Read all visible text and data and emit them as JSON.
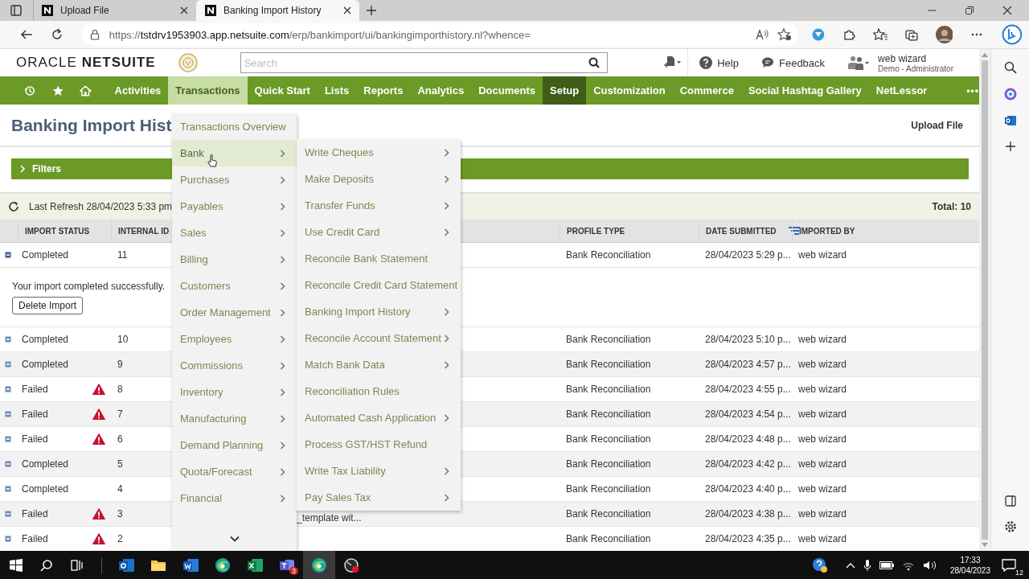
{
  "browser": {
    "tabs": [
      {
        "title": "Upload File",
        "selected": false
      },
      {
        "title": "Banking Import History",
        "selected": true
      }
    ],
    "address": {
      "scheme": "https://",
      "host": "tstdrv1953903.app.netsuite.com",
      "path": "/erp/bankimport/ui/bankingimporthistory.nl?whence="
    }
  },
  "header": {
    "logo": "ORACLE **NETSUITE**",
    "search": {
      "placeholder": "Search"
    },
    "help": "Help",
    "feedback": "Feedback",
    "user": {
      "name": "web wizard",
      "role": "Demo - Administrator"
    }
  },
  "nav": [
    {
      "kind": "recent"
    },
    {
      "kind": "favorites"
    },
    {
      "kind": "home"
    },
    {
      "kind": "menu",
      "label": "Activities",
      "selected": false,
      "current": false
    },
    {
      "kind": "menu",
      "label": "Transactions",
      "selected": true,
      "current": false
    },
    {
      "kind": "menu",
      "label": "Quick Start",
      "selected": false,
      "current": false
    },
    {
      "kind": "menu",
      "label": "Lists",
      "selected": false,
      "current": false
    },
    {
      "kind": "menu",
      "label": "Reports",
      "selected": false,
      "current": false
    },
    {
      "kind": "menu",
      "label": "Analytics",
      "selected": false,
      "current": false
    },
    {
      "kind": "menu",
      "label": "Documents",
      "selected": false,
      "current": false
    },
    {
      "kind": "menu",
      "label": "Setup",
      "selected": false,
      "current": true
    },
    {
      "kind": "menu",
      "label": "Customization",
      "selected": false,
      "current": false
    },
    {
      "kind": "menu",
      "label": "Commerce",
      "selected": false,
      "current": false
    },
    {
      "kind": "menu",
      "label": "Social Hashtag Gallery",
      "selected": false,
      "current": false
    },
    {
      "kind": "menu",
      "label": "NetLessor",
      "selected": false,
      "current": false
    },
    {
      "kind": "more",
      "label": "•••"
    }
  ],
  "page": {
    "title": "Banking Import Hist",
    "action": "Upload File",
    "filters": "Filters",
    "last_refresh": "Last Refresh 28/04/2023 5:33 pm",
    "total": "Total: 10"
  },
  "table": {
    "columns": [
      {
        "label": "IMPORT STATUS",
        "sorted": false
      },
      {
        "label": "INTERNAL ID",
        "sorted": false
      },
      {
        "label": "PROFILE TYPE",
        "sorted": false
      },
      {
        "label": "DATE SUBMITTED",
        "sorted": true
      },
      {
        "label": "IMPORTED BY",
        "sorted": false
      }
    ],
    "rows": [
      {
        "status": "Completed",
        "failed": false,
        "id": "11",
        "profile": "Bank Reconciliation",
        "date": "28/04/2023 5:29 p...",
        "by": "web wizard",
        "expanded": true,
        "detail": {
          "message": "Your import completed successfully.",
          "button": "Delete Import"
        }
      },
      {
        "status": "Completed",
        "failed": false,
        "id": "10",
        "profile": "Bank Reconciliation",
        "date": "28/04/2023 5:10 p...",
        "by": "web wizard",
        "expanded": false
      },
      {
        "status": "Completed",
        "failed": false,
        "id": "9",
        "profile": "Bank Reconciliation",
        "date": "28/04/2023 4:57 p...",
        "by": "web wizard",
        "expanded": false
      },
      {
        "status": "Failed",
        "failed": true,
        "id": "8",
        "profile": "Bank Reconciliation",
        "date": "28/04/2023 4:55 p...",
        "by": "web wizard",
        "expanded": false
      },
      {
        "status": "Failed",
        "failed": true,
        "id": "7",
        "profile": "Bank Reconciliation",
        "date": "28/04/2023 4:54 p...",
        "by": "web wizard",
        "expanded": false
      },
      {
        "status": "Failed",
        "failed": true,
        "id": "6",
        "profile": "Bank Reconciliation",
        "date": "28/04/2023 4:48 p...",
        "by": "web wizard",
        "expanded": false
      },
      {
        "status": "Completed",
        "failed": false,
        "id": "5",
        "profile": "Bank Reconciliation",
        "date": "28/04/2023 4:42 p...",
        "by": "web wizard",
        "expanded": false
      },
      {
        "status": "Completed",
        "failed": false,
        "id": "4",
        "profile": "Bank Reconciliation",
        "date": "28/04/2023 4:40 p...",
        "by": "web wizard",
        "expanded": false
      },
      {
        "status": "Failed",
        "failed": true,
        "id": "3",
        "column_3": "_template wit...",
        "profile": "Bank Reconciliation",
        "date": "28/04/2023 4:38 p...",
        "by": "web wizard",
        "expanded": false
      },
      {
        "status": "Failed",
        "failed": true,
        "id": "2",
        "profile": "Bank Reconciliation",
        "date": "28/04/2023 4:35 p...",
        "by": "web wizard",
        "expanded": false
      }
    ]
  },
  "menus": [
    {
      "items": [
        {
          "label": "Transactions Overview",
          "submenu": false,
          "selected": false
        },
        {
          "label": "Bank",
          "submenu": true,
          "selected": true
        },
        {
          "label": "Purchases",
          "submenu": true,
          "selected": false
        },
        {
          "label": "Payables",
          "submenu": true,
          "selected": false
        },
        {
          "label": "Sales",
          "submenu": true,
          "selected": false
        },
        {
          "label": "Billing",
          "submenu": true,
          "selected": false
        },
        {
          "label": "Customers",
          "submenu": true,
          "selected": false
        },
        {
          "label": "Order Management",
          "submenu": true,
          "selected": false
        },
        {
          "label": "Employees",
          "submenu": true,
          "selected": false
        },
        {
          "label": "Commissions",
          "submenu": true,
          "selected": false
        },
        {
          "label": "Inventory",
          "submenu": true,
          "selected": false
        },
        {
          "label": "Manufacturing",
          "submenu": true,
          "selected": false
        },
        {
          "label": "Demand Planning",
          "submenu": true,
          "selected": false
        },
        {
          "label": "Quota/Forecast",
          "submenu": true,
          "selected": false
        },
        {
          "label": "Financial",
          "submenu": true,
          "selected": false
        }
      ]
    },
    {
      "items": [
        {
          "label": "Write Cheques",
          "submenu": true,
          "selected": false
        },
        {
          "label": "Make Deposits",
          "submenu": true,
          "selected": false
        },
        {
          "label": "Transfer Funds",
          "submenu": true,
          "selected": false
        },
        {
          "label": "Use Credit Card",
          "submenu": true,
          "selected": false
        },
        {
          "label": "Reconcile Bank Statement",
          "submenu": false,
          "selected": false
        },
        {
          "label": "Reconcile Credit Card Statement",
          "submenu": false,
          "selected": false
        },
        {
          "label": "Banking Import History",
          "submenu": true,
          "selected": false
        },
        {
          "label": "Reconcile Account Statement",
          "submenu": true,
          "selected": false
        },
        {
          "label": "Match Bank Data",
          "submenu": true,
          "selected": false
        },
        {
          "label": "Reconciliation Rules",
          "submenu": false,
          "selected": false
        },
        {
          "label": "Automated Cash Application",
          "submenu": true,
          "selected": false
        },
        {
          "label": "Process GST/HST Refund",
          "submenu": false,
          "selected": false
        },
        {
          "label": "Write Tax Liability",
          "submenu": true,
          "selected": false
        },
        {
          "label": "Pay Sales Tax",
          "submenu": true,
          "selected": false
        }
      ]
    }
  ],
  "taskbar": {
    "apps": [
      {
        "kind": "outlook",
        "active": false
      },
      {
        "kind": "folder",
        "active": false
      },
      {
        "kind": "word",
        "active": false
      },
      {
        "kind": "edge",
        "active": false
      },
      {
        "kind": "excel",
        "active": false
      },
      {
        "kind": "teams",
        "active": false,
        "badge": "3"
      },
      {
        "kind": "edge",
        "active": true
      },
      {
        "kind": "recorder",
        "active": false
      }
    ],
    "time": "17:33",
    "date": "28/04/2023",
    "notifications": "12"
  }
}
